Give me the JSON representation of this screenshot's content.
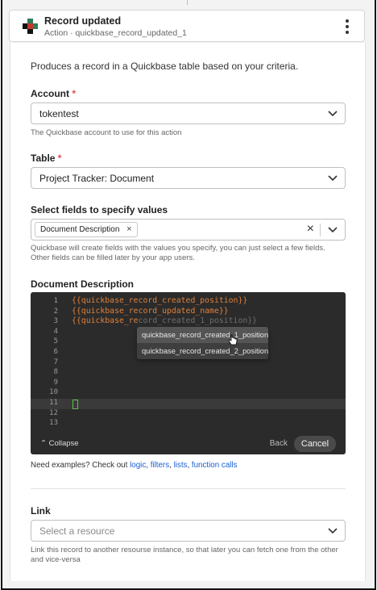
{
  "header": {
    "title": "Record updated",
    "subtitle": "Action · quickbase_record_updated_1",
    "brand_colors": [
      "#2e7d5b",
      "#c0392b",
      "#111111"
    ]
  },
  "description": "Produces a record in a Quickbase table based on your criteria.",
  "account": {
    "label": "Account",
    "required_mark": "*",
    "value": "tokentest",
    "help": "The Quickbase account to use for this action"
  },
  "table": {
    "label": "Table",
    "required_mark": "*",
    "value": "Project Tracker: Document"
  },
  "fields": {
    "label": "Select fields to specify values",
    "chip": "Document Description",
    "chip_remove": "×",
    "clear": "×",
    "help": "Quickbase will create fields with the values you specify, you can just select a few fields. Other fields can be filled later by your app users."
  },
  "doc_desc": {
    "label": "Document Description",
    "line_numbers": [
      "1",
      "2",
      "3",
      "4",
      "5",
      "6",
      "7",
      "8",
      "9",
      "10",
      "11",
      "12",
      "13"
    ],
    "lines": [
      "{{quickbase_record_created_position}}",
      "{{quickbase_record_updated_name}}",
      "{{quickbase_re"
    ],
    "ghost_suffix": "cord_created_1_position}}",
    "autocomplete": [
      "quickbase_record_created_1_position",
      "quickbase_record_created_2_position"
    ],
    "collapse": "Collapse",
    "back": "Back",
    "cancel": "Cancel"
  },
  "examples": {
    "prefix": "Need examples? Check out ",
    "links": [
      "logic",
      "filters",
      "lists",
      "function calls"
    ]
  },
  "link": {
    "label": "Link",
    "placeholder": "Select a resource",
    "help": "Link this record to another resourse instance, so that later you can fetch one from the other and vice-versa"
  },
  "icons": [
    "quickbase-logo-icon",
    "kebab-menu-icon",
    "chevron-down-icon",
    "close-icon",
    "chevron-up-icon",
    "pointer-cursor-icon"
  ]
}
